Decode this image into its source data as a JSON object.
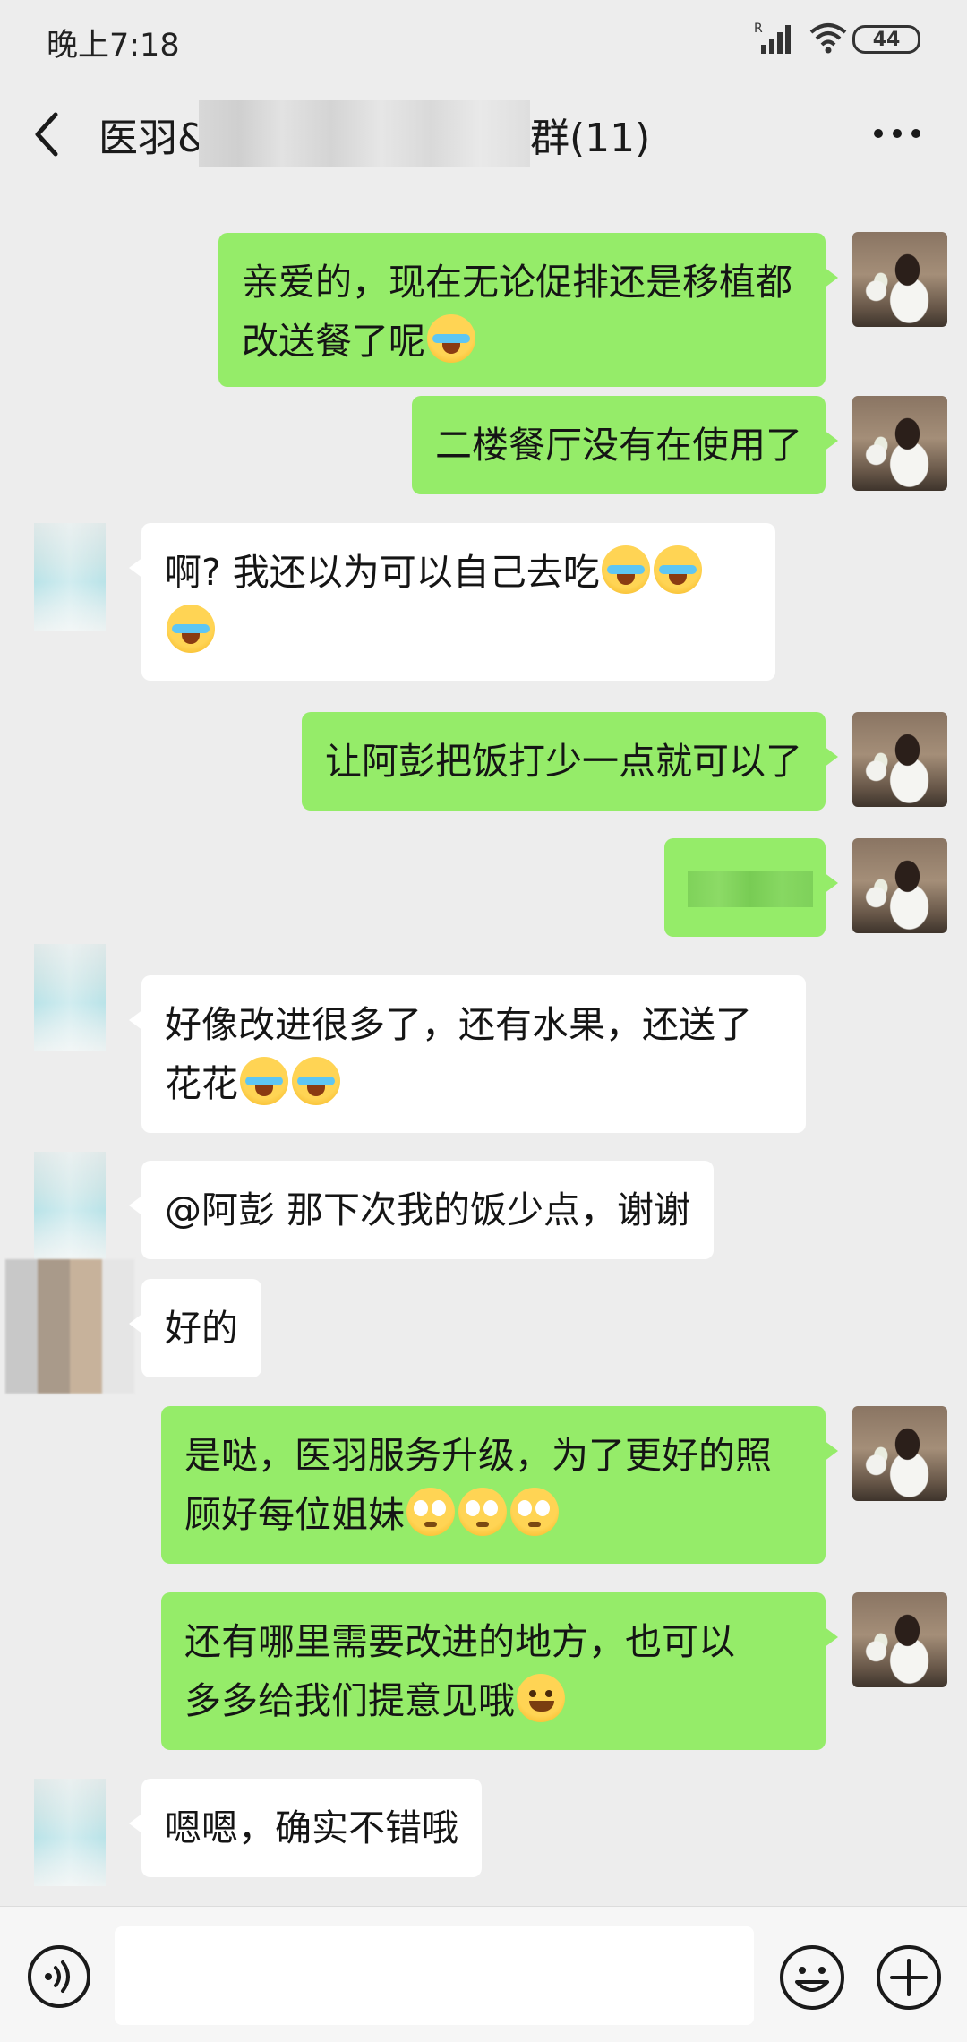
{
  "status_bar": {
    "time": "晚上7:18",
    "battery": "44"
  },
  "header": {
    "title_prefix": "医羽&",
    "title_suffix": "群(11)"
  },
  "messages": [
    {
      "side": "me",
      "lines": [
        "亲爱的，现在无论促排还是移植都",
        "改送餐了呢"
      ],
      "emoji": [
        "tears-of-joy"
      ]
    },
    {
      "side": "me",
      "lines": [
        "二楼餐厅没有在使用了"
      ]
    },
    {
      "side": "other",
      "lines": [
        "啊? 我还以为可以自己去吃"
      ],
      "emoji": [
        "loudly-crying",
        "loudly-crying",
        "loudly-crying"
      ]
    },
    {
      "side": "me",
      "lines": [
        "让阿彭把饭打少一点就可以了"
      ]
    },
    {
      "side": "me",
      "lines": [],
      "redacted": true
    },
    {
      "side": "other",
      "lines": [
        "好像改进很多了，还有水果，还送了",
        "花花"
      ],
      "emoji": [
        "loudly-crying",
        "loudly-crying"
      ]
    },
    {
      "side": "other",
      "lines": [
        "@阿彭  那下次我的饭少点，谢谢"
      ]
    },
    {
      "side": "other",
      "lines": [
        "好的"
      ]
    },
    {
      "side": "me",
      "lines": [
        "是哒，医羽服务升级，为了更好的照",
        "顾好每位姐妹"
      ],
      "emoji": [
        "pleading",
        "pleading",
        "pleading"
      ]
    },
    {
      "side": "me",
      "lines": [
        "还有哪里需要改进的地方，也可以",
        "多多给我们提意见哦"
      ],
      "emoji": [
        "hugging"
      ]
    },
    {
      "side": "other",
      "lines": [
        "嗯嗯，确实不错哦"
      ]
    }
  ],
  "icons": {
    "back": "back-arrow-icon",
    "more": "more-icon",
    "voice": "voice-icon",
    "emoji": "emoji-icon",
    "plus": "plus-icon"
  },
  "colors": {
    "background": "#ededed",
    "bubble_me": "#95ec69",
    "bubble_other": "#ffffff"
  }
}
